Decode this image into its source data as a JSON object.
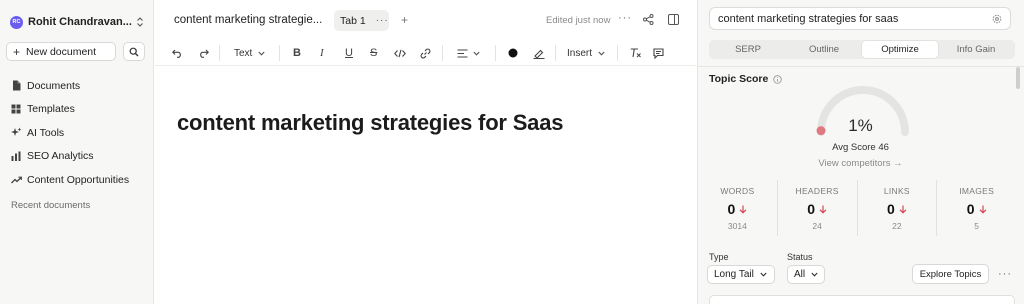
{
  "sidebar": {
    "workspace": {
      "initials": "RC",
      "name": "Rohit Chandravan...",
      "avatar_color": "#6a5df0"
    },
    "new_document_label": "New document",
    "items": [
      {
        "label": "Documents",
        "icon": "document-icon"
      },
      {
        "label": "Templates",
        "icon": "grid-icon"
      },
      {
        "label": "AI Tools",
        "icon": "sparkle-icon"
      },
      {
        "label": "SEO Analytics",
        "icon": "bar-chart-icon"
      },
      {
        "label": "Content Opportunities",
        "icon": "trend-icon"
      }
    ],
    "recent_label": "Recent documents"
  },
  "editor": {
    "doc_title": "content marketing strategie...",
    "tab_label": "Tab 1",
    "status": "Edited just now",
    "toolbar": {
      "text_style": "Text",
      "insert_label": "Insert"
    },
    "heading": "content marketing strategies for Saas"
  },
  "panel": {
    "keyword": "content marketing strategies for saas",
    "tabs": [
      "SERP",
      "Outline",
      "Optimize",
      "Info Gain"
    ],
    "active_tab": "Optimize",
    "topic_score_label": "Topic Score",
    "score": "1%",
    "score_fraction": 0.01,
    "avg_score": "Avg Score 46",
    "view_competitors": "View competitors →",
    "metrics": [
      {
        "label": "WORDS",
        "value": "0",
        "target": "3014"
      },
      {
        "label": "HEADERS",
        "value": "0",
        "target": "24"
      },
      {
        "label": "LINKS",
        "value": "0",
        "target": "22"
      },
      {
        "label": "IMAGES",
        "value": "0",
        "target": "5"
      }
    ],
    "type_label": "Type",
    "type_value": "Long Tail",
    "status_label": "Status",
    "status_value": "All",
    "explore_label": "Explore Topics"
  },
  "colors": {
    "score_low": "#e07a82",
    "down_arrow": "#d64550",
    "gauge_track": "#e4e4e2"
  }
}
